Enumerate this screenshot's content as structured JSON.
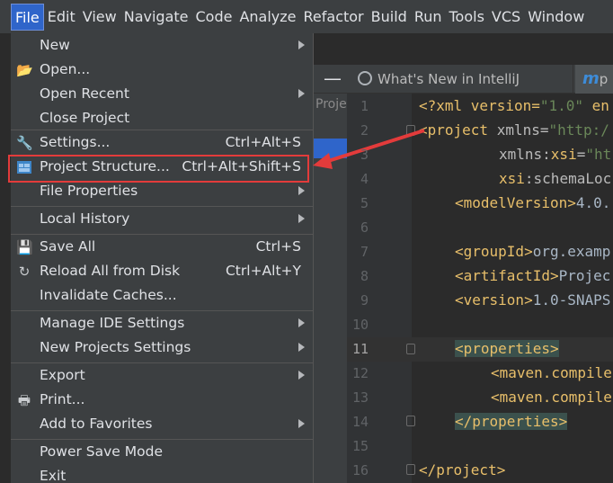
{
  "menubar": {
    "items": [
      "File",
      "Edit",
      "View",
      "Navigate",
      "Code",
      "Analyze",
      "Refactor",
      "Build",
      "Run",
      "Tools",
      "VCS",
      "Window"
    ],
    "active": "File"
  },
  "editor": {
    "tabs": [
      {
        "label": "What's New in IntelliJ IDEA",
        "close": "×"
      },
      {
        "label": "p",
        "icon": "m"
      }
    ],
    "project_strip_label": "Proje",
    "minimize": "—",
    "line_numbers": [
      "1",
      "2",
      "3",
      "4",
      "5",
      "6",
      "7",
      "8",
      "9",
      "10",
      "11",
      "12",
      "13",
      "14",
      "15",
      "16"
    ],
    "current_line": "11",
    "code": {
      "l1": [
        "<?xml version=",
        "\"1.0\"",
        " en"
      ],
      "l2_tag": "<project",
      "l2_attr": " xmlns=",
      "l2_val": "\"http:/",
      "l3_attr": "xmlns:",
      "l3_attr2": "xsi",
      "l3_eq": "=",
      "l3_val": "\"ht",
      "l4_attr": "xsi",
      "l4_rest": ":schemaLoc",
      "l5_tag": "<modelVersion>",
      "l5_txt": "4.0.",
      "l7_tag": "<groupId>",
      "l7_txt": "org.examp",
      "l8_tag": "<artifactId>",
      "l8_txt": "Projec",
      "l9_tag": "<version>",
      "l9_txt": "1.0-SNAPS",
      "l11_tag": "<properties>",
      "l12_tag": "<maven.compile",
      "l13_tag": "<maven.compile",
      "l14_tag": "</properties>",
      "l16_tag": "</project>"
    }
  },
  "file_menu": {
    "items": [
      {
        "id": "new",
        "label": "New",
        "shortcut": "",
        "submenu": true,
        "icon": ""
      },
      {
        "id": "open",
        "label": "Open...",
        "shortcut": "",
        "submenu": false,
        "icon": "folder-icon"
      },
      {
        "id": "open-recent",
        "label": "Open Recent",
        "shortcut": "",
        "submenu": true,
        "icon": ""
      },
      {
        "id": "close-project",
        "label": "Close Project",
        "shortcut": "",
        "submenu": false,
        "icon": ""
      },
      {
        "id": "settings",
        "label": "Settings...",
        "shortcut": "Ctrl+Alt+S",
        "submenu": false,
        "icon": "wrench-icon"
      },
      {
        "id": "project-structure",
        "label": "Project Structure...",
        "shortcut": "Ctrl+Alt+Shift+S",
        "submenu": false,
        "icon": "project-structure-icon"
      },
      {
        "id": "file-properties",
        "label": "File Properties",
        "shortcut": "",
        "submenu": true,
        "icon": ""
      },
      {
        "id": "local-history",
        "label": "Local History",
        "shortcut": "",
        "submenu": true,
        "icon": ""
      },
      {
        "id": "save-all",
        "label": "Save All",
        "shortcut": "Ctrl+S",
        "submenu": false,
        "icon": "save-icon"
      },
      {
        "id": "reload",
        "label": "Reload All from Disk",
        "shortcut": "Ctrl+Alt+Y",
        "submenu": false,
        "icon": "reload-icon"
      },
      {
        "id": "invalidate",
        "label": "Invalidate Caches...",
        "shortcut": "",
        "submenu": false,
        "icon": ""
      },
      {
        "id": "manage-ide",
        "label": "Manage IDE Settings",
        "shortcut": "",
        "submenu": true,
        "icon": ""
      },
      {
        "id": "new-projects-settings",
        "label": "New Projects Settings",
        "shortcut": "",
        "submenu": true,
        "icon": ""
      },
      {
        "id": "export",
        "label": "Export",
        "shortcut": "",
        "submenu": true,
        "icon": ""
      },
      {
        "id": "print",
        "label": "Print...",
        "shortcut": "",
        "submenu": false,
        "icon": "print-icon"
      },
      {
        "id": "add-favorites",
        "label": "Add to Favorites",
        "shortcut": "",
        "submenu": true,
        "icon": ""
      },
      {
        "id": "power-save",
        "label": "Power Save Mode",
        "shortcut": "",
        "submenu": false,
        "icon": ""
      },
      {
        "id": "exit",
        "label": "Exit",
        "shortcut": "",
        "submenu": false,
        "icon": ""
      }
    ],
    "highlighted": "project-structure"
  },
  "colors": {
    "menu_bg": "#3c3f41",
    "selection": "#2f65ca",
    "annotation_red": "#e33b3b",
    "editor_bg": "#2b2b2b"
  }
}
